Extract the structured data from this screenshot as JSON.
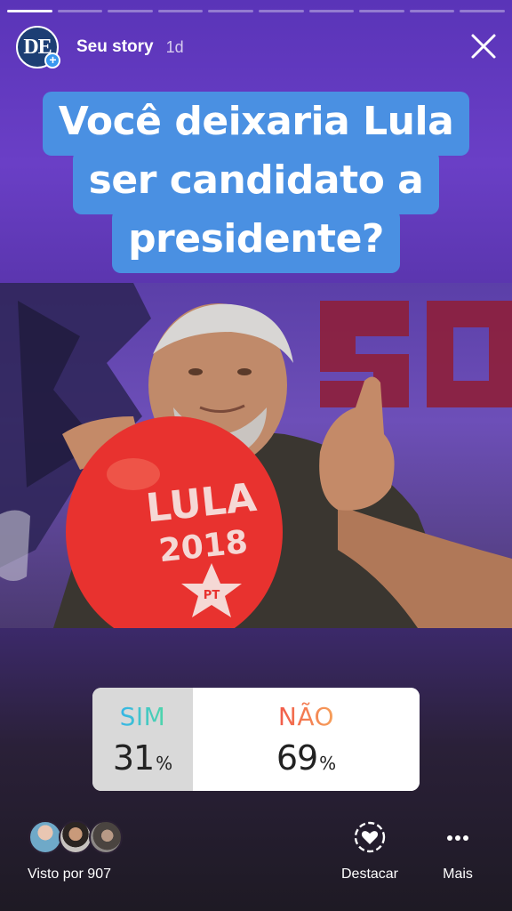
{
  "progress": {
    "segments": 10,
    "active_index": 0
  },
  "header": {
    "avatar_text": "DE",
    "username": "Seu story",
    "time": "1d"
  },
  "question": {
    "lines": [
      "Você deixaria Lula",
      "ser candidato a",
      "presidente?"
    ]
  },
  "photo": {
    "balloon_text_line1": "LULA",
    "balloon_text_line2": "2018",
    "balloon_star_text": "PT"
  },
  "poll": {
    "options": [
      {
        "label": "SIM",
        "percent": "31",
        "suffix": "%"
      },
      {
        "label": "NÃO",
        "percent": "69",
        "suffix": "%"
      }
    ]
  },
  "footer": {
    "seen_text": "Visto por 907",
    "highlight_label": "Destacar",
    "more_label": "Mais"
  },
  "colors": {
    "question_bg": "#4a90e2",
    "sim_gradient": [
      "#35b5e8",
      "#4fd6a9"
    ],
    "nao_gradient": [
      "#f15a4a",
      "#f6a05a"
    ]
  },
  "icons": [
    "plus-icon",
    "close-icon",
    "heart-circle-icon",
    "more-dots-icon"
  ]
}
